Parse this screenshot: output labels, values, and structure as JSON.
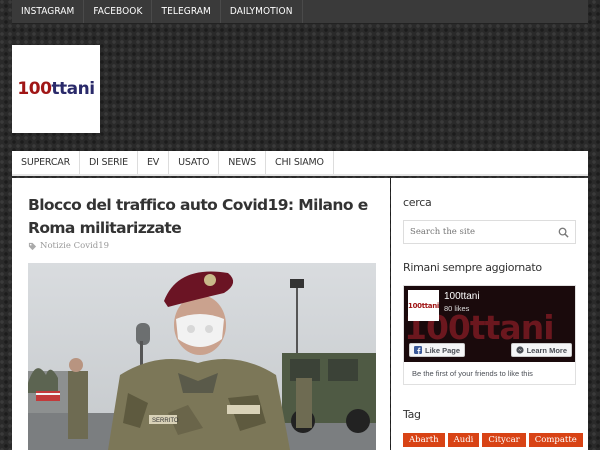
{
  "topnav": [
    "INSTAGRAM",
    "FACEBOOK",
    "TELEGRAM",
    "DAILYMOTION"
  ],
  "logo": {
    "text_accent": "100",
    "text_main": "ttani",
    "alt": "100ttani"
  },
  "mainnav": [
    "SUPERCAR",
    "DI SERIE",
    "EV",
    "USATO",
    "NEWS",
    "CHI SIAMO"
  ],
  "article": {
    "title": "Blocco del traffico auto Covid19: Milano e Roma militarizzate",
    "category": "Notizie Covid19",
    "photo_caption_name": "SERRITO"
  },
  "sidebar": {
    "search_title": "cerca",
    "search_placeholder": "Search the site",
    "follow_title": "Rimani sempre aggiornato",
    "facebook": {
      "page_name": "100ttani",
      "likes": "80 likes",
      "avatar_text": "100ttani",
      "cover_text": "100ttani",
      "like_button": "Like Page",
      "learn_button": "Learn More",
      "friends_text": "Be the first of your friends to like this"
    },
    "tag_title": "Tag",
    "tags": [
      "Abarth",
      "Audi",
      "Citycar",
      "Compatte"
    ]
  },
  "colors": {
    "accent": "#d84315",
    "topbar": "#3a3a3a",
    "logo_red": "#a01616"
  }
}
